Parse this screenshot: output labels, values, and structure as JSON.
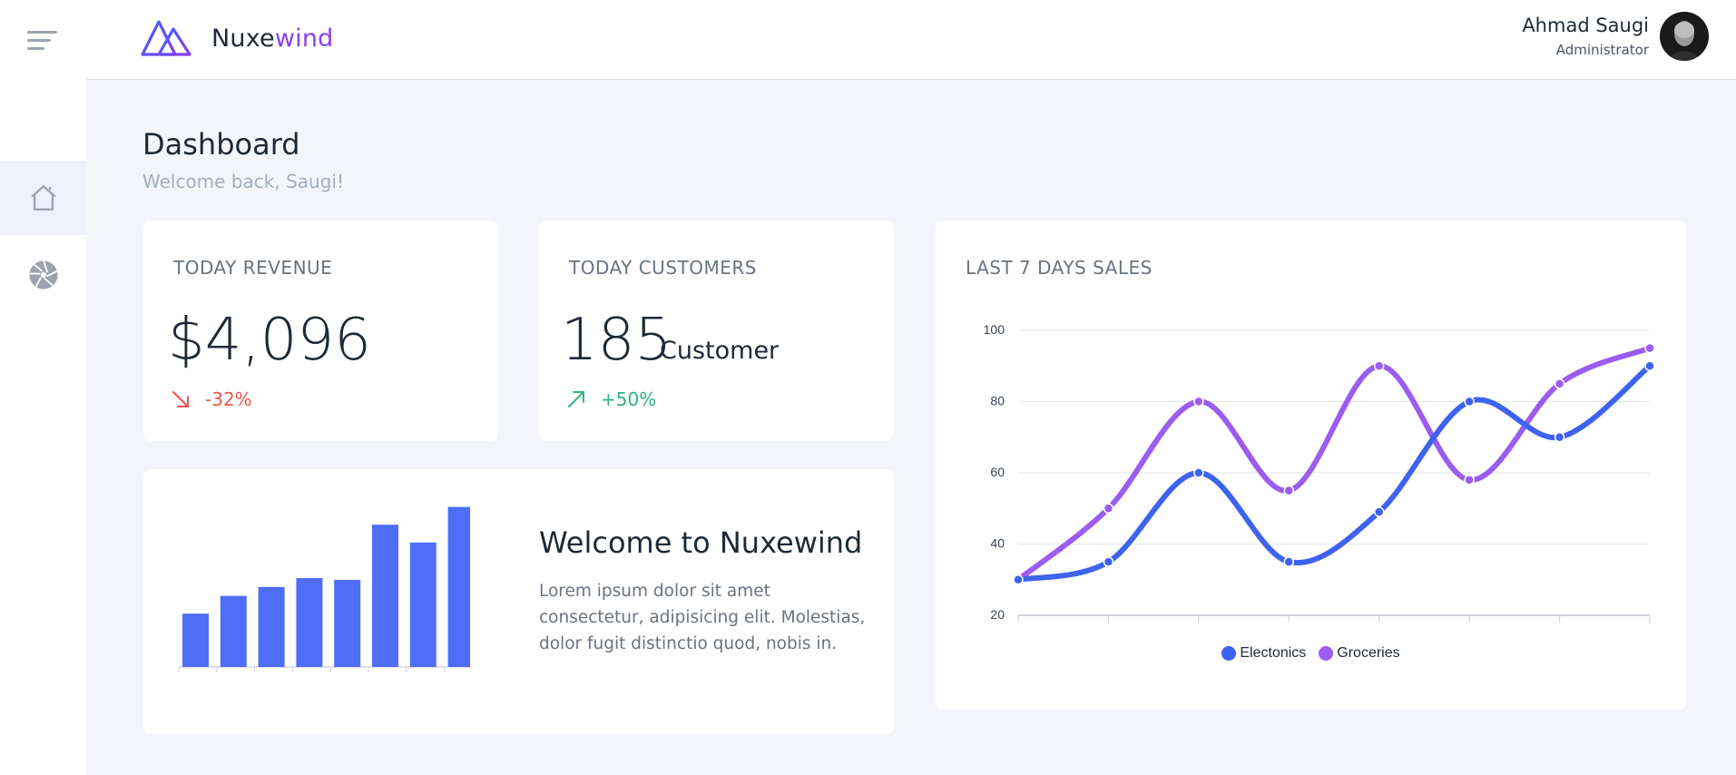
{
  "app": {
    "name_prefix": "Nuxe",
    "name_accent": "wind"
  },
  "user": {
    "name": "Ahmad Saugi",
    "role": "Administrator"
  },
  "sidebar": {
    "items": [
      {
        "icon": "home-icon",
        "active": true
      },
      {
        "icon": "aperture-icon",
        "active": false
      }
    ]
  },
  "page": {
    "title": "Dashboard",
    "subtitle": "Welcome back, Saugi!"
  },
  "revenue": {
    "label": "TODAY REVENUE",
    "value": "$4,096",
    "change": "-32%",
    "direction": "down"
  },
  "customers": {
    "label": "TODAY CUSTOMERS",
    "value": "185",
    "unit": "Customer",
    "change": "+50%",
    "direction": "up"
  },
  "welcome": {
    "title": "Welcome to Nuxewind",
    "text": "Lorem ipsum dolor sit amet consectetur, adipisicing elit. Molestias, dolor fugit distinctio quod, nobis in."
  },
  "colors": {
    "accent": "#8b3ef0",
    "bar": "#4f6ef7",
    "electronics": "#3e63f0",
    "groceries": "#9b5cf0",
    "down": "#ef5350",
    "up": "#2eb67d"
  },
  "chart_data": [
    {
      "type": "bar",
      "values": [
        30,
        40,
        45,
        50,
        49,
        80,
        70,
        90
      ],
      "ylim": [
        0,
        100
      ]
    },
    {
      "type": "line",
      "title": "LAST 7 DAYS SALES",
      "ylim": [
        20,
        100
      ],
      "yticks": [
        20,
        40,
        60,
        80,
        100
      ],
      "grid": true,
      "legend": "bottom-center",
      "series": [
        {
          "name": "Electonics",
          "values": [
            30,
            35,
            60,
            35,
            49,
            80,
            70,
            90
          ]
        },
        {
          "name": "Groceries",
          "values": [
            30,
            50,
            80,
            55,
            90,
            58,
            85,
            95
          ]
        }
      ]
    }
  ]
}
